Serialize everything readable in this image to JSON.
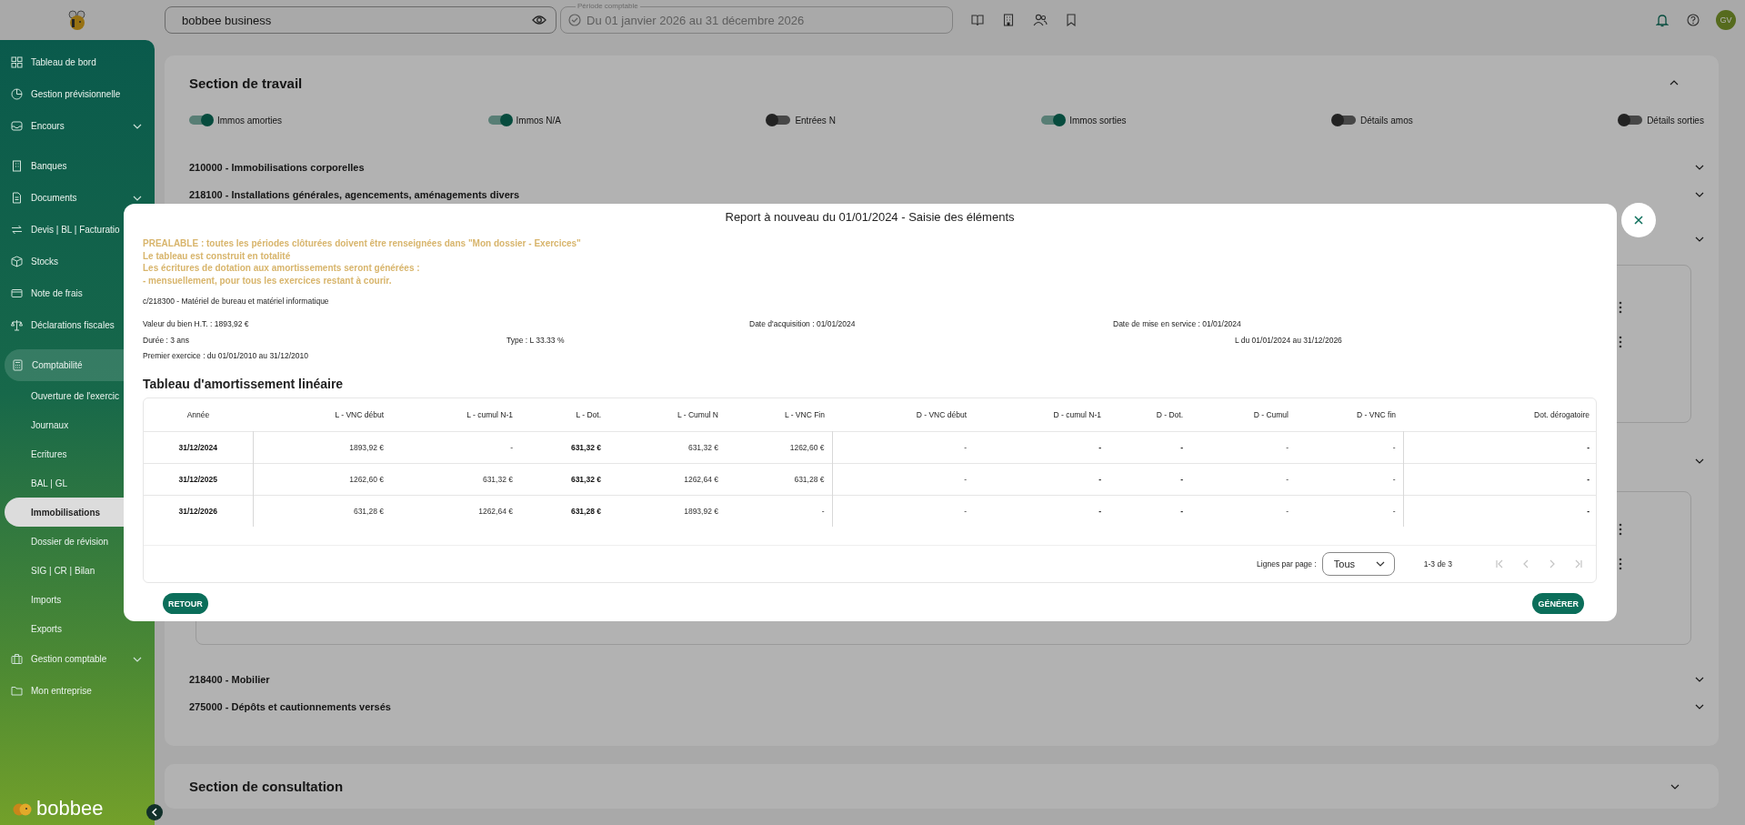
{
  "topbar": {
    "company": "bobbee business",
    "period_label": "Période comptable",
    "period": "Du 01 janvier 2026 au 31 décembre 2026",
    "avatar": "GV"
  },
  "sidebar": {
    "items": [
      {
        "label": "Tableau de bord",
        "selected": false
      },
      {
        "label": "Gestion prévisionnelle",
        "selected": false
      },
      {
        "label": "Encours",
        "selected": false,
        "expanded": false
      },
      {
        "label": "Banques",
        "selected": false
      },
      {
        "label": "Documents",
        "selected": false,
        "expanded": false
      },
      {
        "label": "Devis | BL | Facturatio",
        "selected": false
      },
      {
        "label": "Stocks",
        "selected": false
      },
      {
        "label": "Note de frais",
        "selected": false
      },
      {
        "label": "Déclarations fiscales",
        "selected": false
      },
      {
        "label": "Comptabilité",
        "selected": false,
        "expanded": true,
        "children": [
          {
            "label": "Ouverture de l'exercic",
            "selected": false
          },
          {
            "label": "Journaux",
            "selected": false
          },
          {
            "label": "Ecritures",
            "selected": false
          },
          {
            "label": "BAL | GL",
            "selected": false
          },
          {
            "label": "Immobilisations",
            "selected": true
          },
          {
            "label": "Dossier de révision",
            "selected": false
          },
          {
            "label": "SIG | CR | Bilan",
            "selected": false
          },
          {
            "label": "Imports",
            "selected": false
          },
          {
            "label": "Exports",
            "selected": false
          }
        ]
      },
      {
        "label": "Gestion comptable",
        "selected": false,
        "expanded": false
      },
      {
        "label": "Mon entreprise",
        "selected": false
      }
    ],
    "brand": "bobbee"
  },
  "work_section": {
    "title": "Section de travail",
    "toggles": [
      {
        "label": "Immos amorties",
        "on": true
      },
      {
        "label": "Immos N/A",
        "on": true
      },
      {
        "label": "Entrées N",
        "on": false
      },
      {
        "label": "Immos sorties",
        "on": true
      },
      {
        "label": "Détails amos",
        "on": false
      },
      {
        "label": "Détails sorties",
        "on": false
      }
    ],
    "accounts_top": [
      "210000 - Immobilisations corporelles",
      "218100 - Installations générales, agencements, aménagements divers"
    ],
    "accounts_bottom": [
      "218400 - Mobilier",
      "275000 - Dépôts et cautionnements versés"
    ]
  },
  "consult_section": {
    "title": "Section de consultation"
  },
  "modal": {
    "title": "Report à nouveau du 01/01/2024 - Saisie des éléments",
    "notes": [
      "PREALABLE : toutes les périodes clôturées doivent être renseignées dans \"Mon dossier - Exercices\"",
      "Le tableau est construit en totalité",
      "Les écritures de dotation aux amortissements seront générées :",
      "- mensuellement, pour tous les exercices restant à courir."
    ],
    "account": "c/218300 - Matériel de bureau et matériel informatique",
    "info_rows": [
      [
        "Valeur du bien H.T. : 1893,92 €",
        "Date d'acquisition : 01/01/2024",
        "Date de mise en service : 01/01/2024"
      ],
      [
        "Durée : 3 ans",
        "Type : L 33.33 %",
        "L du 01/01/2024 au 31/12/2026"
      ],
      [
        "Premier exercice : du 01/01/2010 au 31/12/2010"
      ]
    ],
    "table_title": "Tableau d'amortissement linéaire",
    "columns": [
      {
        "label": "Année",
        "bold": true,
        "divider": true
      },
      {
        "label": "L - VNC début",
        "bold": false,
        "divider": false
      },
      {
        "label": "L - cumul N-1",
        "bold": false,
        "divider": false
      },
      {
        "label": "L - Dot.",
        "bold": true,
        "divider": false
      },
      {
        "label": "L - Cumul N",
        "bold": false,
        "divider": false
      },
      {
        "label": "L - VNC Fin",
        "bold": false,
        "divider": true
      },
      {
        "label": "D - VNC début",
        "bold": false,
        "divider": false
      },
      {
        "label": "D - cumul N-1",
        "bold": true,
        "divider": false
      },
      {
        "label": "D - Dot.",
        "bold": true,
        "divider": false
      },
      {
        "label": "D - Cumul",
        "bold": false,
        "divider": false
      },
      {
        "label": "D - VNC fin",
        "bold": false,
        "divider": true
      },
      {
        "label": "Dot. dérogatoire",
        "bold": true,
        "divider": false
      }
    ],
    "rows": [
      [
        "31/12/2024",
        "1893,92 €",
        "-",
        "631,32 €",
        "631,32 €",
        "1262,60 €",
        "-",
        "-",
        "-",
        "-",
        "-",
        "-"
      ],
      [
        "31/12/2025",
        "1262,60 €",
        "631,32 €",
        "631,32 €",
        "1262,64 €",
        "631,28 €",
        "-",
        "-",
        "-",
        "-",
        "-",
        "-"
      ],
      [
        "31/12/2026",
        "631,28 €",
        "1262,64 €",
        "631,28 €",
        "1893,92 €",
        "-",
        "-",
        "-",
        "-",
        "-",
        "-",
        "-"
      ]
    ],
    "rows_per_page_label": "Lignes par page :",
    "rows_per_page": "Tous",
    "range": "1-3 de 3",
    "back_button": "RETOUR",
    "generate_button": "GÉNÉRER"
  }
}
